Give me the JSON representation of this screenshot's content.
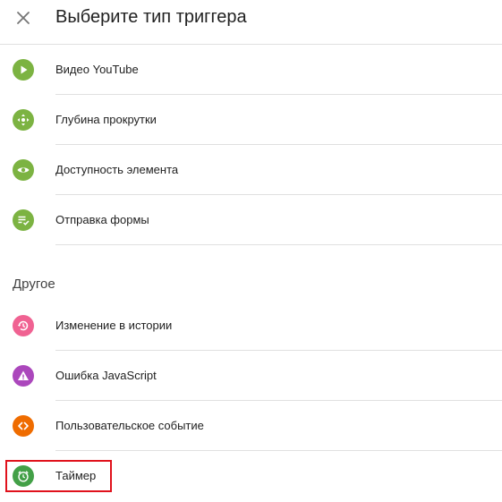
{
  "header": {
    "title": "Выберите тип триггера",
    "close_icon": "close-icon"
  },
  "items": [
    {
      "label": "Видео YouTube",
      "icon": "play-icon",
      "color": "#7cb342"
    },
    {
      "label": "Глубина прокрутки",
      "icon": "move-arrows-icon",
      "color": "#7cb342"
    },
    {
      "label": "Доступность элемента",
      "icon": "eye-icon",
      "color": "#7cb342"
    },
    {
      "label": "Отправка формы",
      "icon": "form-check-icon",
      "color": "#7cb342"
    }
  ],
  "section": {
    "title": "Другое"
  },
  "other_items": [
    {
      "label": "Изменение в истории",
      "icon": "history-icon",
      "color": "#f06292"
    },
    {
      "label": "Ошибка JavaScript",
      "icon": "warning-icon",
      "color": "#ab47bc"
    },
    {
      "label": "Пользовательское событие",
      "icon": "code-icon",
      "color": "#ef6c00"
    },
    {
      "label": "Таймер",
      "icon": "alarm-clock-icon",
      "color": "#43a047"
    }
  ],
  "highlight_color": "#e0121c"
}
